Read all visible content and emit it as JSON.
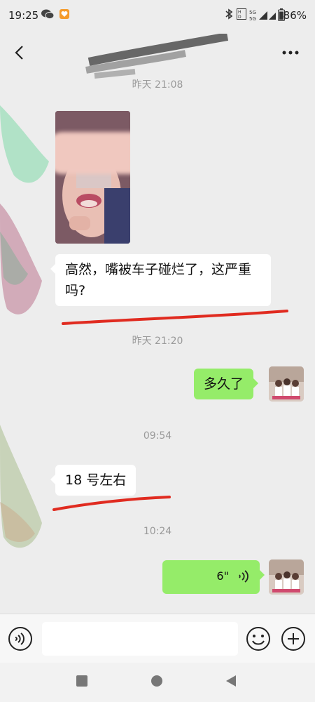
{
  "status_bar": {
    "time": "19:25",
    "battery_percent": "86%",
    "icons": [
      "wechat-icon",
      "heart-app-icon",
      "bluetooth-icon",
      "hd-icon",
      "signal-5g-icon",
      "signal-5g-icon",
      "battery-icon"
    ]
  },
  "header": {
    "back_icon": "back-arrow-icon",
    "more_icon": "more-dots-icon",
    "title_redacted": true
  },
  "messages": [
    {
      "type": "timestamp",
      "text": "昨天 21:08"
    },
    {
      "type": "image",
      "side": "left",
      "description_hidden": true
    },
    {
      "type": "text",
      "side": "left",
      "text": "高然，嘴被车子碰烂了，这严重吗?"
    },
    {
      "type": "timestamp",
      "text": "昨天 21:20"
    },
    {
      "type": "text",
      "side": "right",
      "text": "多久了"
    },
    {
      "type": "timestamp",
      "text": "09:54"
    },
    {
      "type": "text",
      "side": "left",
      "text": "18 号左右"
    },
    {
      "type": "timestamp",
      "text": "10:24"
    },
    {
      "type": "voice",
      "side": "right",
      "duration": "6\""
    }
  ],
  "input_bar": {
    "voice_icon": "voice-toggle-icon",
    "emoji_icon": "emoji-icon",
    "plus_icon": "plus-icon",
    "placeholder": ""
  },
  "nav_bar": {
    "icons": [
      "recents-square-icon",
      "home-circle-icon",
      "back-triangle-icon"
    ]
  },
  "colors": {
    "background": "#ededed",
    "bubble_mine": "#95ec69",
    "bubble_theirs": "#ffffff",
    "annotation_red": "#e02b20"
  }
}
